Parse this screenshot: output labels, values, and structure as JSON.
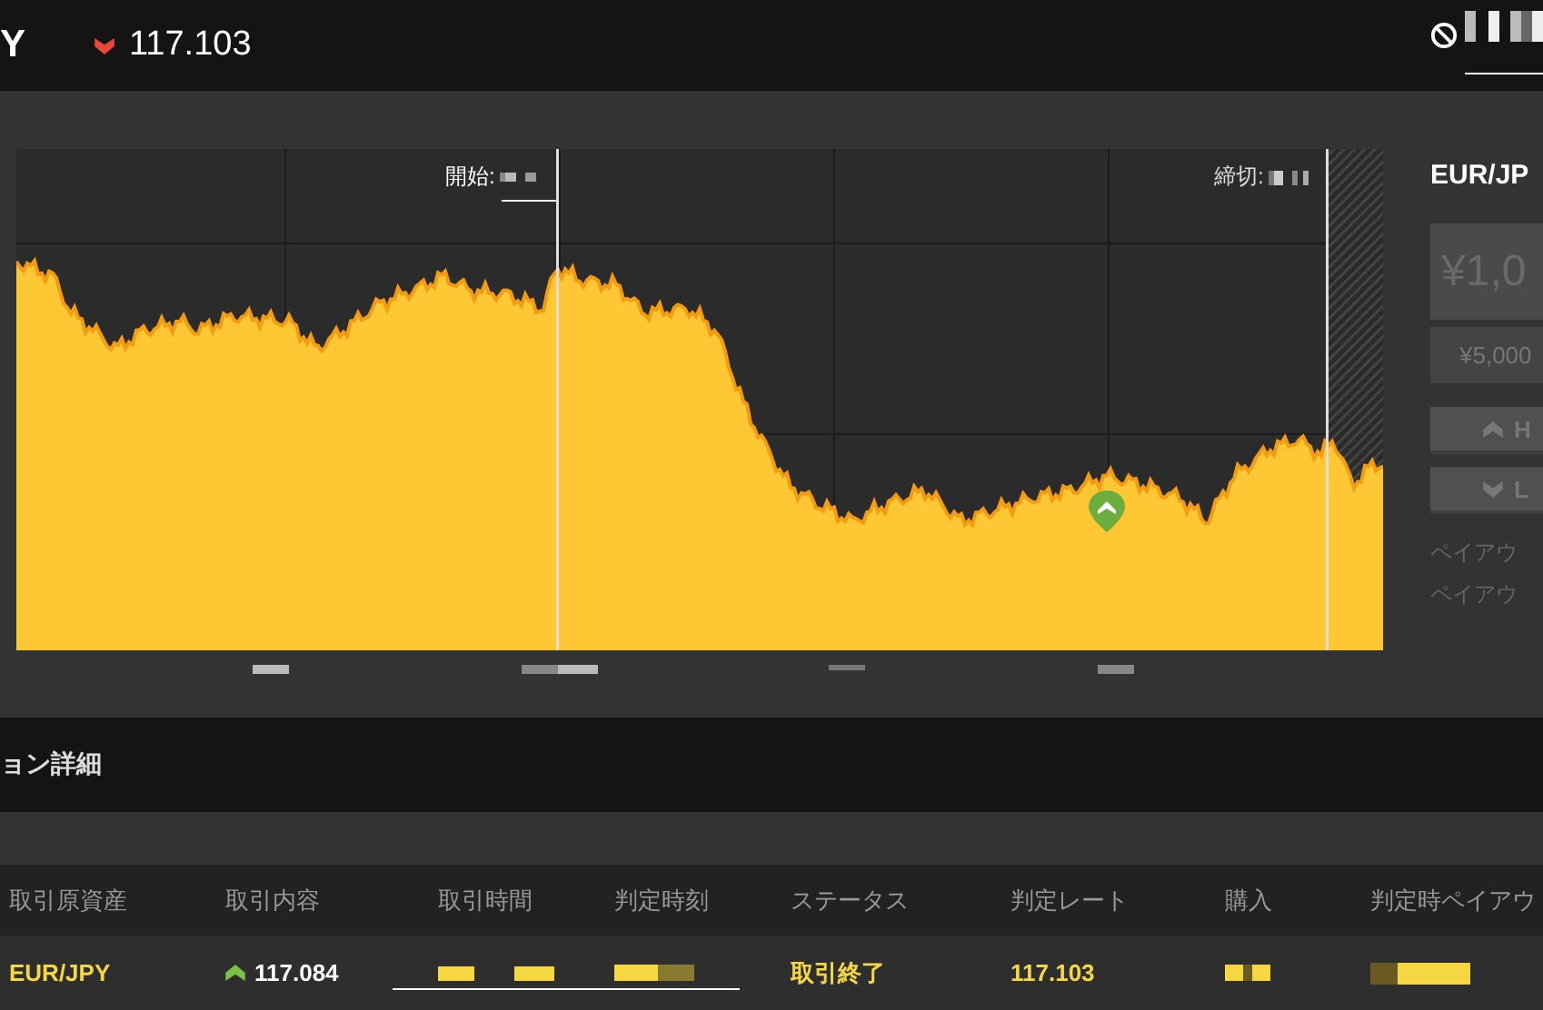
{
  "header": {
    "symbol_fragment": "Y",
    "kind": "down",
    "rate": "117.103"
  },
  "chart": {
    "start_label": "開始:",
    "end_label": "締切:"
  },
  "order_panel": {
    "asset": "EUR/JP",
    "amount": "¥1,0",
    "preset": "¥5,000",
    "high": "H",
    "low": "L",
    "payout_lines": [
      "ペイアウ",
      "ペイアウ"
    ]
  },
  "section_title": "ョン詳細",
  "table": {
    "columns": [
      "取引原資産",
      "取引内容",
      "取引時間",
      "判定時刻",
      "ステータス",
      "判定レート",
      "購入",
      "判定時ペイアウ"
    ],
    "rows": [
      {
        "asset": "EUR/JPY",
        "kind": "high",
        "entry_rate": "117.084",
        "status": "取引終了",
        "closing_rate": "117.103"
      }
    ]
  }
}
